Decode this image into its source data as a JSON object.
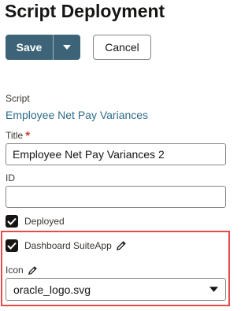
{
  "page": {
    "title": "Script Deployment"
  },
  "toolbar": {
    "save_label": "Save",
    "cancel_label": "Cancel"
  },
  "script": {
    "label": "Script",
    "value": "Employee Net Pay Variances"
  },
  "title_field": {
    "label": "Title",
    "required_marker": "*",
    "value": "Employee Net Pay Variances 2"
  },
  "id_field": {
    "label": "ID",
    "value": ""
  },
  "deployed": {
    "label": "Deployed",
    "checked": true
  },
  "dashboard_suiteapp": {
    "label": "Dashboard SuiteApp",
    "checked": true
  },
  "icon_field": {
    "label": "Icon",
    "value": "oracle_logo.svg"
  },
  "colors": {
    "accent": "#3d6378",
    "link": "#2e6c8a",
    "required": "#c74634",
    "highlight": "#e34c4c"
  }
}
